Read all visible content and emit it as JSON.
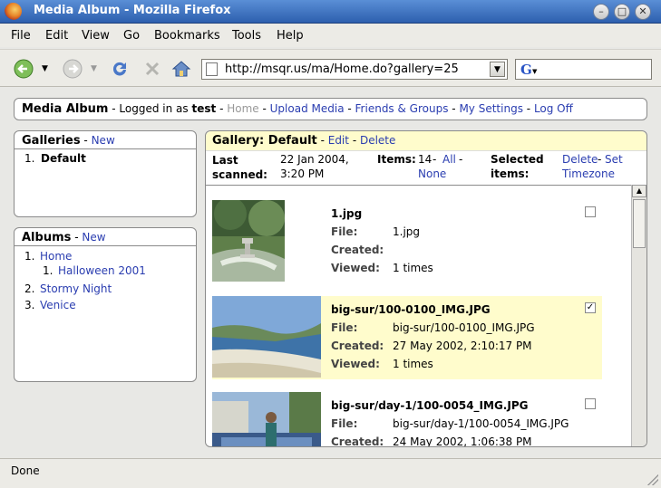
{
  "window": {
    "title": "Media Album - Mozilla Firefox"
  },
  "menu": [
    "File",
    "Edit",
    "View",
    "Go",
    "Bookmarks",
    "Tools",
    "Help"
  ],
  "nav": {
    "url": "http://msqr.us/ma/Home.do?gallery=25",
    "search_value": ""
  },
  "topbar": {
    "app_name": "Media Album",
    "logged_in_prefix": "- Logged in as",
    "user": "test",
    "links": [
      "Home",
      "Upload Media",
      "Friends & Groups",
      "My Settings",
      "Log Off"
    ]
  },
  "galleries": {
    "heading": "Galleries",
    "new_label": "New",
    "items": [
      {
        "num": "1.",
        "label": "Default"
      }
    ]
  },
  "albums": {
    "heading": "Albums",
    "new_label": "New",
    "items": [
      {
        "num": "1.",
        "label": "Home"
      },
      {
        "num": "1.",
        "label": "Halloween 2001"
      },
      {
        "num": "2.",
        "label": "Stormy Night"
      },
      {
        "num": "3.",
        "label": "Venice"
      }
    ]
  },
  "gallery": {
    "title": "Gallery: Default",
    "edit_label": "Edit",
    "delete_label": "Delete",
    "last_scanned_label": "Last scanned:",
    "last_scanned_line1": "22 Jan 2004,",
    "last_scanned_line2": "3:20 PM",
    "items_label": "Items:",
    "items_count": "14",
    "all_label": "All",
    "none_label": "None",
    "selected_label_1": "Selected",
    "selected_label_2": "items:",
    "sel_delete": "Delete",
    "sel_set": "Set",
    "sel_timezone": "Timezone",
    "field_labels": {
      "file": "File:",
      "created": "Created:",
      "viewed": "Viewed:"
    },
    "media": [
      {
        "name": "1.jpg",
        "file": "1.jpg",
        "created": "",
        "viewed": "1 times",
        "checked": false
      },
      {
        "name": "big-sur/100-0100_IMG.JPG",
        "file": "big-sur/100-0100_IMG.JPG",
        "created": "27 May 2002, 2:10:17 PM",
        "viewed": "1 times",
        "checked": true
      },
      {
        "name": "big-sur/day-1/100-0054_IMG.JPG",
        "file": "big-sur/day-1/100-0054_IMG.JPG",
        "created": "24 May 2002, 1:06:38 PM",
        "viewed": "",
        "checked": false
      }
    ]
  },
  "status": {
    "text": "Done"
  },
  "colors": {
    "link": "#2a3db0",
    "selected_row": "#fffccc",
    "title_bar": "#2d5fae"
  }
}
